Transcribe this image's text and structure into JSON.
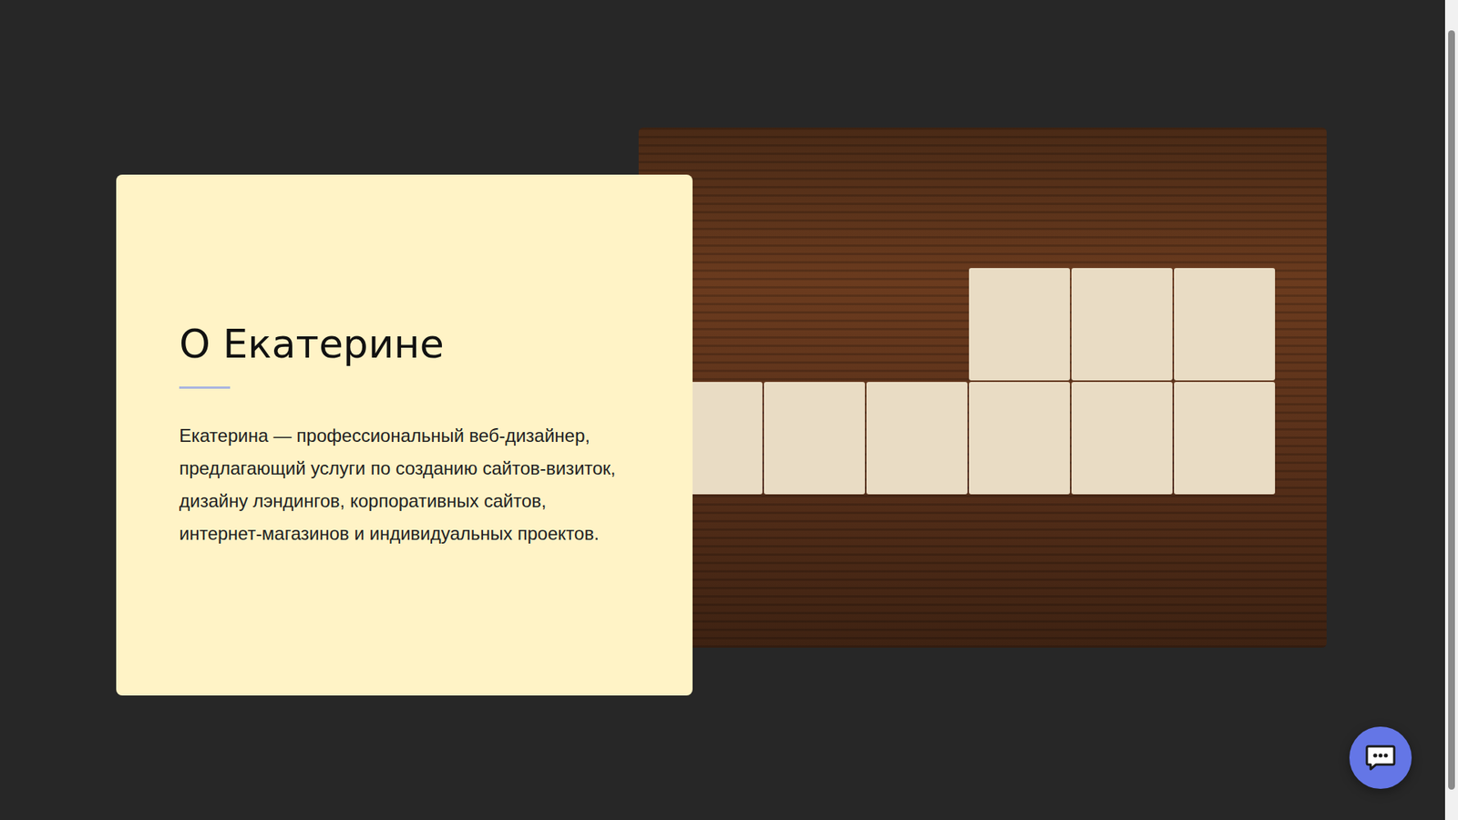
{
  "about": {
    "title": "О Екатерине",
    "text": "Екатерина — профессиональный веб-дизайнер, предлагающий услуги по созданию сайтов-визиток, дизайну лэндингов, корпоративных сайтов, интернет-магазинов и индивидуальных проектов."
  }
}
